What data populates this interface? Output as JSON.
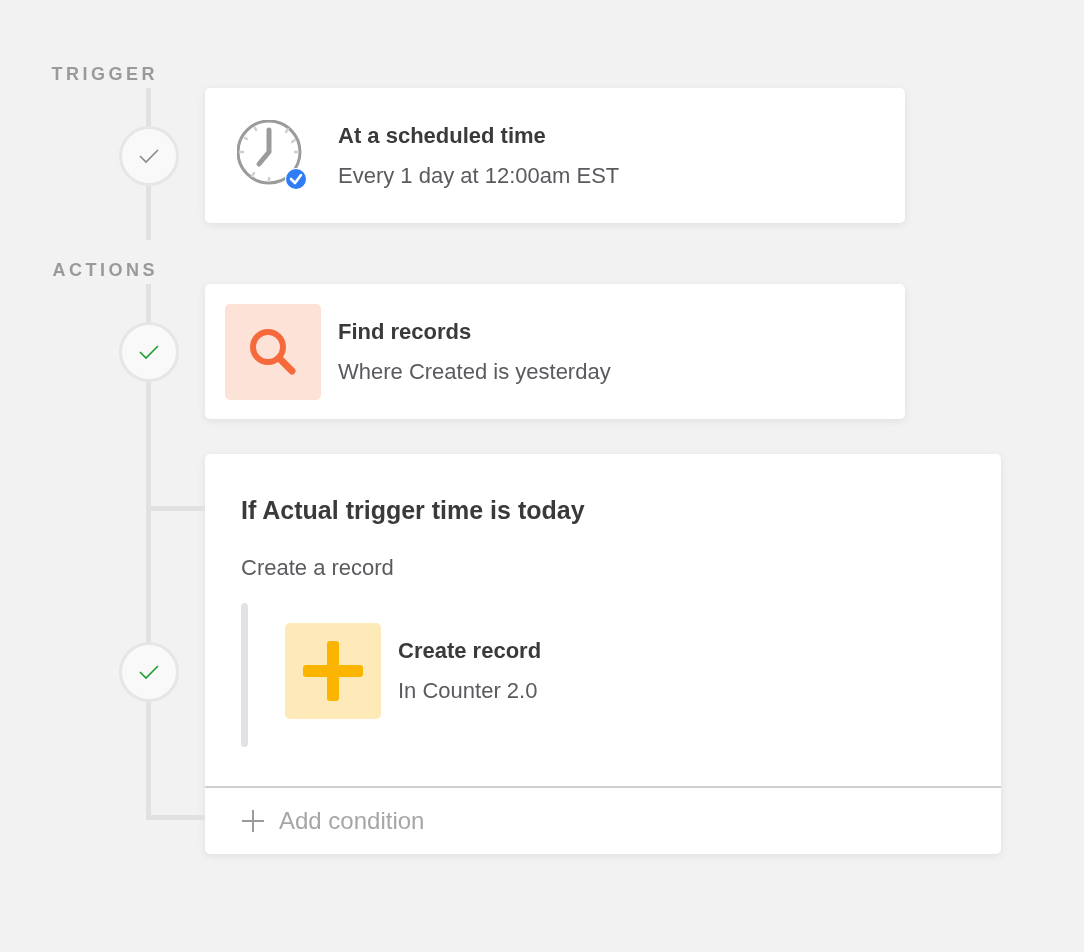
{
  "sections": [
    {
      "label": "TRIGGER",
      "steps": [
        {
          "kind": "clock",
          "done": false,
          "title": "At a scheduled time",
          "subtitle": "Every 1 day at 12:00am EST"
        }
      ]
    },
    {
      "label": "ACTIONS",
      "steps": [
        {
          "kind": "search",
          "done": true,
          "title": "Find records",
          "subtitle": "Where Created is yesterday"
        },
        {
          "kind": "condition",
          "done": true,
          "title": "If Actual trigger time is today",
          "subtitle": "Create a record",
          "inner": {
            "kind": "plus",
            "title": "Create record",
            "subtitle": "In Counter 2.0"
          },
          "footer": "Add condition"
        }
      ]
    }
  ]
}
